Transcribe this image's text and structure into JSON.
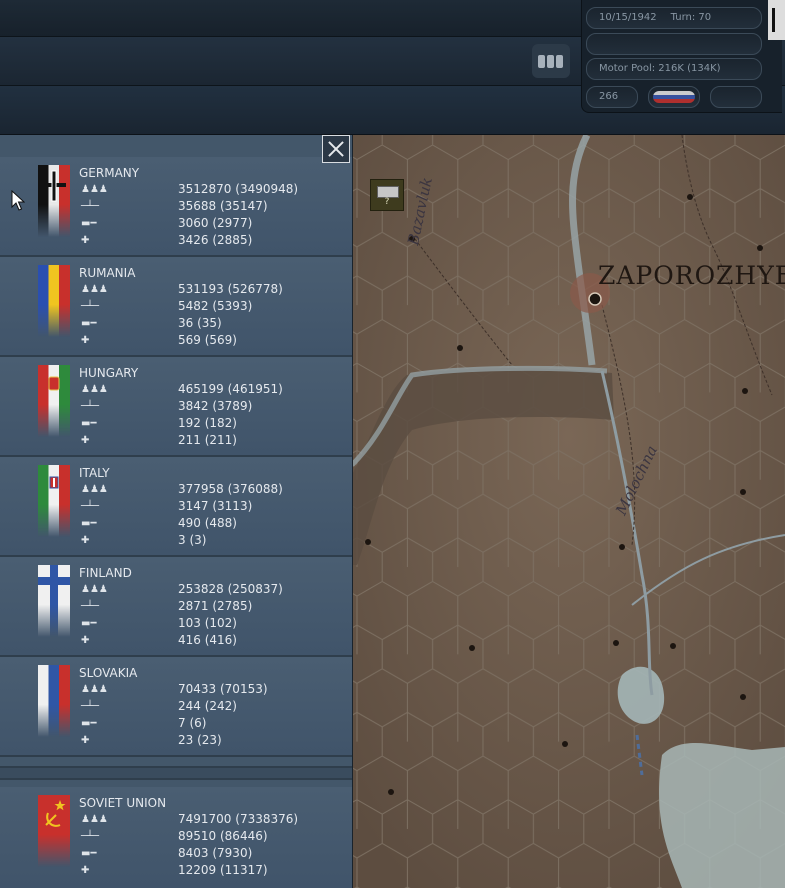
{
  "hud": {
    "date": "10/15/1942",
    "turn": "Turn: 70",
    "motor_pool": "Motor Pool:  216K (134K)",
    "counter": "266"
  },
  "map": {
    "city": "ZAPOROZHYE",
    "river1": "Bazavluk",
    "river2": "Molochna",
    "unknown_unit_label": "?"
  },
  "icons": {
    "manpower": "infantry-icon",
    "guns": "gun-icon",
    "tanks": "tank-icon",
    "aircraft": "aircraft-icon"
  },
  "nations": [
    {
      "name": "GERMANY",
      "manpower": "3512870 (3490948)",
      "guns": "35688 (35147)",
      "tanks": "3060 (2977)",
      "aircraft": "3426 (2885)"
    },
    {
      "name": "RUMANIA",
      "manpower": "531193 (526778)",
      "guns": "5482 (5393)",
      "tanks": "36 (35)",
      "aircraft": "569 (569)"
    },
    {
      "name": "HUNGARY",
      "manpower": "465199 (461951)",
      "guns": "3842 (3789)",
      "tanks": "192 (182)",
      "aircraft": "211 (211)"
    },
    {
      "name": "ITALY",
      "manpower": "377958 (376088)",
      "guns": "3147 (3113)",
      "tanks": "490 (488)",
      "aircraft": "3 (3)"
    },
    {
      "name": "FINLAND",
      "manpower": "253828 (250837)",
      "guns": "2871 (2785)",
      "tanks": "103 (102)",
      "aircraft": "416 (416)"
    },
    {
      "name": "SLOVAKIA",
      "manpower": "70433 (70153)",
      "guns": "244 (242)",
      "tanks": "7 (6)",
      "aircraft": "23 (23)"
    },
    {
      "name": "SOVIET UNION",
      "manpower": "7491700 (7338376)",
      "guns": "89510 (86446)",
      "tanks": "8403 (7930)",
      "aircraft": "12209 (11317)"
    }
  ]
}
